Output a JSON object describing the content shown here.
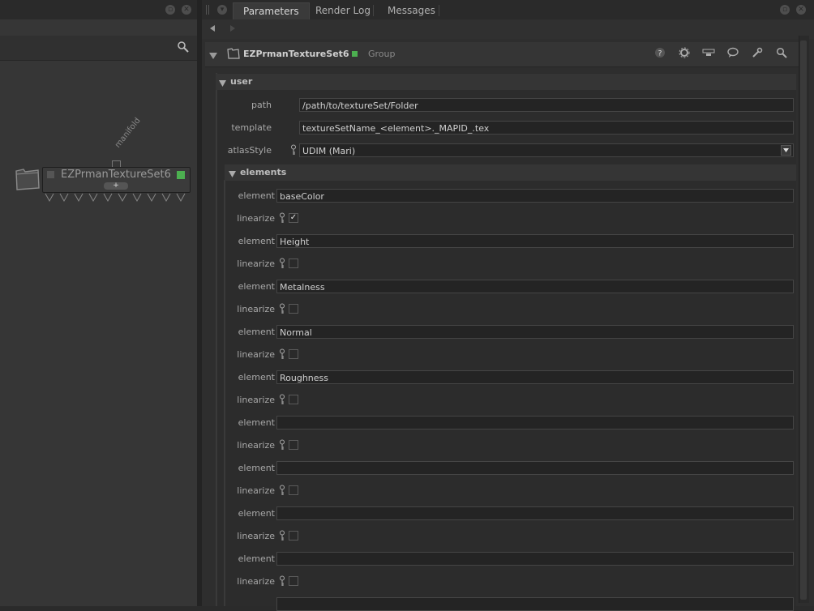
{
  "tabs": [
    "Parameters",
    "Render Log",
    "Messages"
  ],
  "node": {
    "name": "EZPrmanTextureSet6",
    "port_label": "manifold",
    "type_label": "Group"
  },
  "sections": {
    "user_title": "user",
    "elements_title": "elements"
  },
  "user_params": {
    "path_label": "path",
    "path_value": "/path/to/textureSet/Folder",
    "template_label": "template",
    "template_value": "textureSetName_<element>._MAPID_.tex",
    "atlas_label": "atlasStyle",
    "atlas_value": "UDIM (Mari)"
  },
  "element_label": "element",
  "linearize_label": "linearize",
  "elements": [
    {
      "value": "baseColor",
      "linearize": true
    },
    {
      "value": "Height",
      "linearize": false
    },
    {
      "value": "Metalness",
      "linearize": false
    },
    {
      "value": "Normal",
      "linearize": false
    },
    {
      "value": "Roughness",
      "linearize": false
    },
    {
      "value": "",
      "linearize": false
    },
    {
      "value": "",
      "linearize": false
    },
    {
      "value": "",
      "linearize": false
    },
    {
      "value": "",
      "linearize": false
    }
  ],
  "icons": [
    "search-icon",
    "folder-icon",
    "help-icon",
    "gear-icon",
    "layout-icon",
    "chat-icon",
    "wrench-icon",
    "magnifier-icon",
    "triangle-left-icon",
    "triangle-right-icon",
    "key-icon",
    "dropdown-arrow-icon"
  ],
  "colors": {
    "status_green": "#4caf50"
  }
}
